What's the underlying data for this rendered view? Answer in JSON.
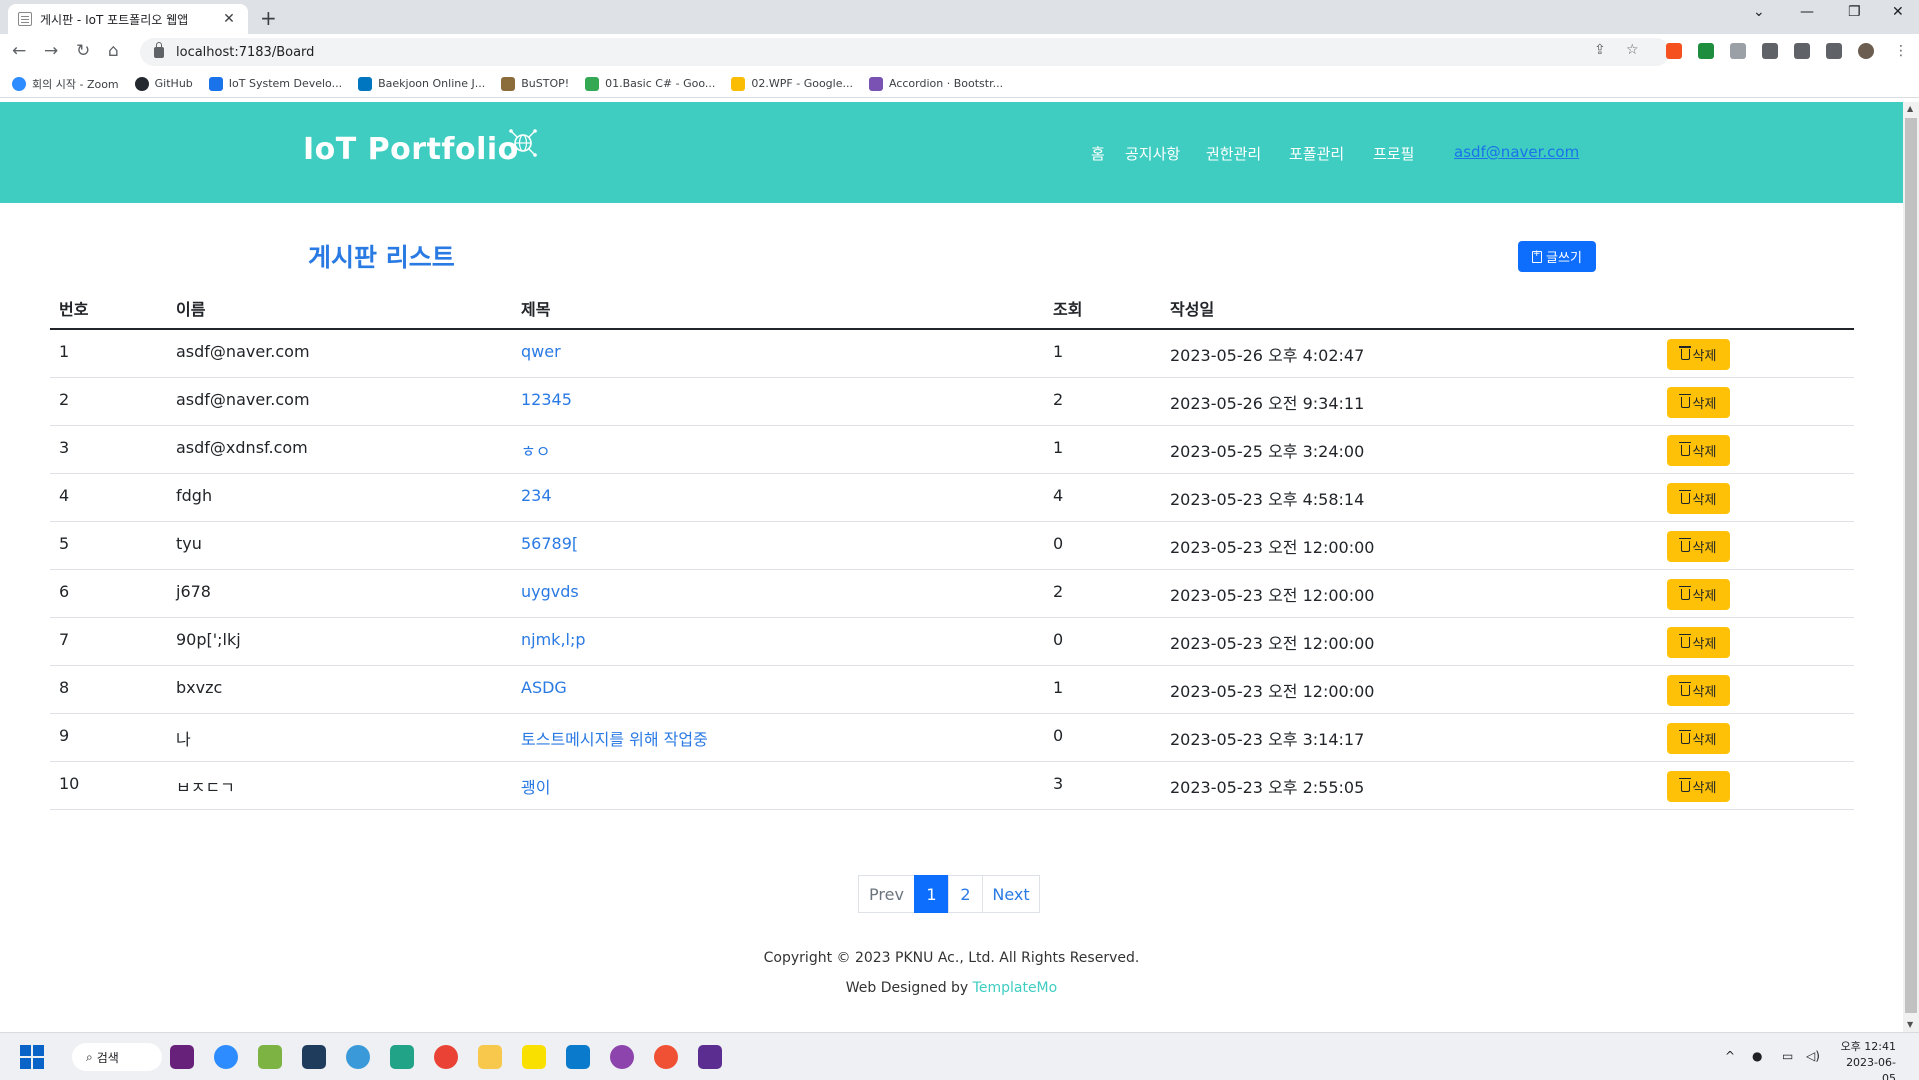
{
  "browser": {
    "tab_title": "게시판 - IoT 포트폴리오 웹앱",
    "tab_close": "✕",
    "new_tab": "+",
    "url": "localhost:7183/Board",
    "bookmarks": [
      {
        "label": "회의 시작 - Zoom",
        "color": "#2d8cff"
      },
      {
        "label": "GitHub",
        "color": "#24292f"
      },
      {
        "label": "IoT System Develo...",
        "color": "#1a73e8"
      },
      {
        "label": "Baekjoon Online J...",
        "color": "#0076c0"
      },
      {
        "label": "BuSTOP!",
        "color": "#8a6d3b"
      },
      {
        "label": "01.Basic C# - Goo...",
        "color": "#34a853"
      },
      {
        "label": "02.WPF - Google...",
        "color": "#fbbc04"
      },
      {
        "label": "Accordion · Bootstr...",
        "color": "#7952b3"
      }
    ]
  },
  "header": {
    "logo": "IoT Portfolio",
    "logo_icon": "circuit-globe-icon",
    "nav": [
      {
        "label": "홈",
        "name": "nav-home"
      },
      {
        "label": "공지사항",
        "name": "nav-notice"
      },
      {
        "label": "권한관리",
        "name": "nav-permissions"
      },
      {
        "label": "포폴관리",
        "name": "nav-portfolio"
      },
      {
        "label": "프로필",
        "name": "nav-profile"
      }
    ],
    "user_email": "asdf@naver.com",
    "bg_color": "#3fcdc2"
  },
  "main": {
    "title": "게시판 리스트",
    "write_button": "글쓰기",
    "columns": [
      "번호",
      "이름",
      "제목",
      "조회",
      "작성일"
    ],
    "delete_label": "삭제",
    "rows": [
      {
        "no": "1",
        "name": "asdf@naver.com",
        "title": "qwer",
        "views": "1",
        "date": "2023-05-26 오후 4:02:47"
      },
      {
        "no": "2",
        "name": "asdf@naver.com",
        "title": "12345",
        "views": "2",
        "date": "2023-05-26 오전 9:34:11"
      },
      {
        "no": "3",
        "name": "asdf@xdnsf.com",
        "title": "ㅎㅇ",
        "views": "1",
        "date": "2023-05-25 오후 3:24:00"
      },
      {
        "no": "4",
        "name": "fdgh",
        "title": "234",
        "views": "4",
        "date": "2023-05-23 오후 4:58:14"
      },
      {
        "no": "5",
        "name": "tyu",
        "title": "56789[",
        "views": "0",
        "date": "2023-05-23 오전 12:00:00"
      },
      {
        "no": "6",
        "name": "j678",
        "title": "uygvds",
        "views": "2",
        "date": "2023-05-23 오전 12:00:00"
      },
      {
        "no": "7",
        "name": "90p[';lkj",
        "title": "njmk,l;p",
        "views": "0",
        "date": "2023-05-23 오전 12:00:00"
      },
      {
        "no": "8",
        "name": "bxvzc",
        "title": "ASDG",
        "views": "1",
        "date": "2023-05-23 오전 12:00:00"
      },
      {
        "no": "9",
        "name": "나",
        "title": "토스트메시지를 위해 작업중",
        "views": "0",
        "date": "2023-05-23 오후 3:14:17"
      },
      {
        "no": "10",
        "name": "ㅂㅈㄷㄱ",
        "title": "괭이",
        "views": "3",
        "date": "2023-05-23 오후 2:55:05"
      }
    ],
    "pagination": {
      "prev": "Prev",
      "pages": [
        "1",
        "2"
      ],
      "current": "1",
      "next": "Next"
    }
  },
  "footer": {
    "copyright": "Copyright © 2023 PKNU Ac., Ltd. All Rights Reserved.",
    "designed_by": "Web Designed by ",
    "designer_link": "TemplateMo"
  },
  "taskbar": {
    "search_label": "검색",
    "clock_time": "오후 12:41",
    "clock_date": "2023-06-05"
  }
}
